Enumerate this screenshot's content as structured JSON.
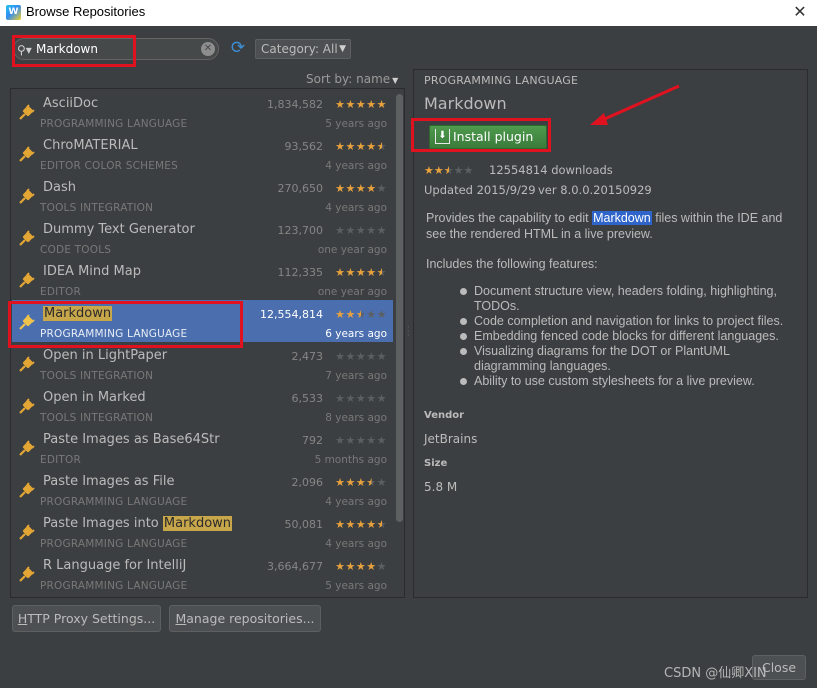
{
  "window": {
    "title": "Browse Repositories",
    "logo_text": "W"
  },
  "toolbar": {
    "search_value": "Markdown",
    "category_label": "Category: All"
  },
  "list": {
    "sort_label": "Sort by: name",
    "rows": [
      {
        "name": "AsciiDoc",
        "category": "PROGRAMMING LANGUAGE",
        "downloads": "1,834,582",
        "age": "5 years ago",
        "rating": 5
      },
      {
        "name": "ChroMATERIAL",
        "category": "EDITOR COLOR SCHEMES",
        "downloads": "93,562",
        "age": "4 years ago",
        "rating": 4.5
      },
      {
        "name": "Dash",
        "category": "TOOLS INTEGRATION",
        "downloads": "270,650",
        "age": "4 years ago",
        "rating": 4
      },
      {
        "name": "Dummy Text Generator",
        "category": "CODE TOOLS",
        "downloads": "123,700",
        "age": "one year ago",
        "rating": 0
      },
      {
        "name": "IDEA Mind Map",
        "category": "EDITOR",
        "downloads": "112,335",
        "age": "one year ago",
        "rating": 4.5
      },
      {
        "name": "Markdown",
        "category": "PROGRAMMING LANGUAGE",
        "downloads": "12,554,814",
        "age": "6 years ago",
        "rating": 2.5,
        "selected": true
      },
      {
        "name": "Open in LightPaper",
        "category": "TOOLS INTEGRATION",
        "downloads": "2,473",
        "age": "7 years ago",
        "rating": 0
      },
      {
        "name": "Open in Marked",
        "category": "TOOLS INTEGRATION",
        "downloads": "6,533",
        "age": "8 years ago",
        "rating": 0
      },
      {
        "name": "Paste Images as Base64Str",
        "category": "EDITOR",
        "downloads": "792",
        "age": "5 months ago",
        "rating": 0
      },
      {
        "name": "Paste Images as File",
        "category": "PROGRAMMING LANGUAGE",
        "downloads": "2,096",
        "age": "4 years ago",
        "rating": 3.5
      },
      {
        "name_prefix": "Paste Images into ",
        "name_highlight": "Markdown",
        "category": "PROGRAMMING LANGUAGE",
        "downloads": "50,081",
        "age": "4 years ago",
        "rating": 4.5
      },
      {
        "name": "R Language for IntelliJ",
        "category": "PROGRAMMING LANGUAGE",
        "downloads": "3,664,677",
        "age": "5 years ago",
        "rating": 4
      }
    ]
  },
  "detail": {
    "category": "PROGRAMMING LANGUAGE",
    "name": "Markdown",
    "install_label": "Install plugin",
    "rating": 2.5,
    "downloads_text": "12554814 downloads",
    "updated": "Updated 2015/9/29",
    "version": "ver 8.0.0.20150929",
    "desc_before": "Provides the capability to edit ",
    "desc_highlight": "Markdown",
    "desc_after": " files within the IDE and see the rendered HTML in a live preview.",
    "features_title": "Includes the following features:",
    "features": [
      "Document structure view, headers folding, highlighting, TODOs.",
      "Code completion and navigation for links to project files.",
      "Embedding fenced code blocks for different languages.",
      "Visualizing diagrams for the DOT or PlantUML diagramming languages.",
      "Ability to use custom stylesheets for a live preview."
    ],
    "vendor_label": "Vendor",
    "vendor": "JetBrains",
    "size_label": "Size",
    "size": "5.8 M"
  },
  "buttons": {
    "proxy": "HTTP Proxy Settings...",
    "manage": "Manage repositories...",
    "close": "Close"
  },
  "watermark": "CSDN @仙卿XIN",
  "colors": {
    "background": "#3c3f41",
    "selection": "#4b6eaf",
    "install_green": "#3b7b3b",
    "annotation_red": "#e0121f",
    "star": "#e8a23d"
  }
}
